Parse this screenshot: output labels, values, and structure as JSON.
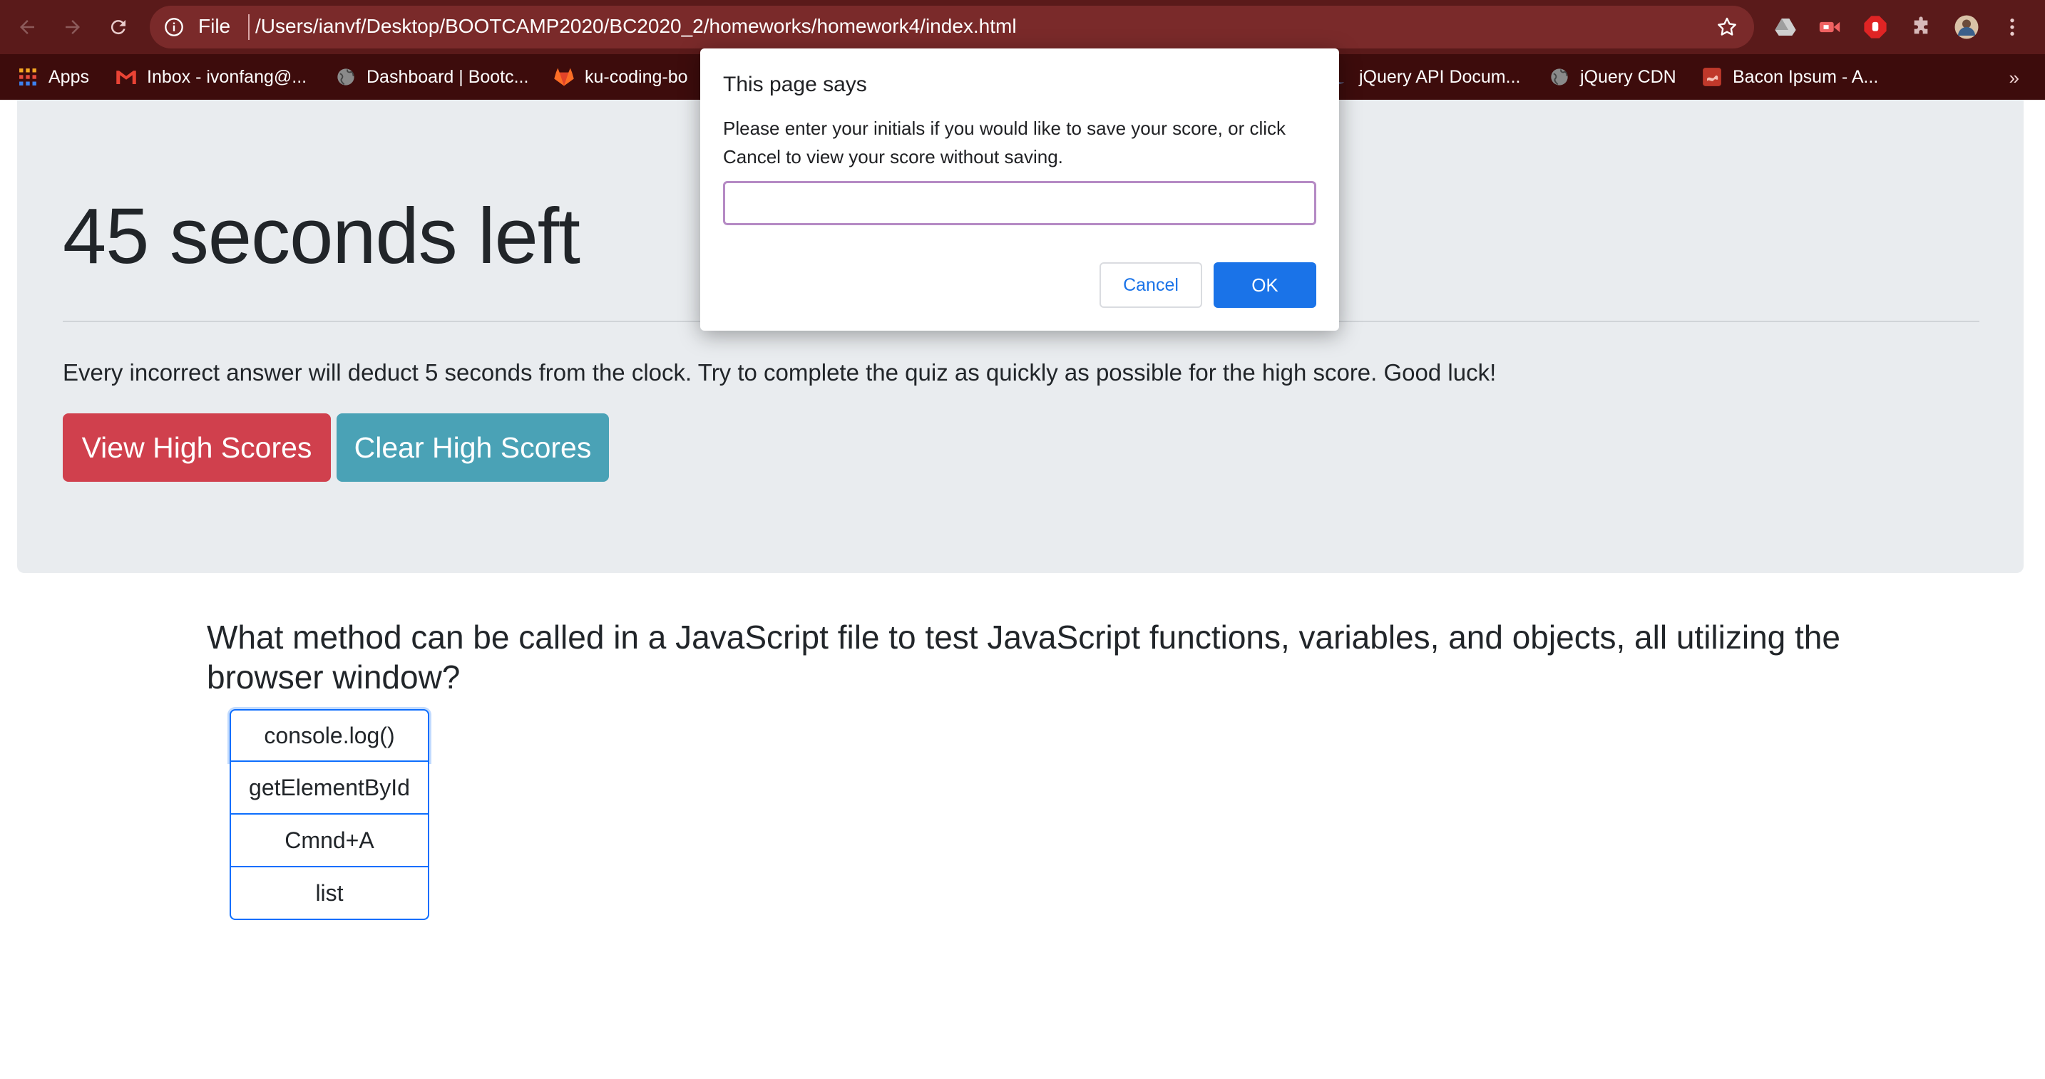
{
  "browser": {
    "scheme_label": "File",
    "url": "/Users/ianvf/Desktop/BOOTCAMP2020/BC2020_2/homeworks/homework4/index.html",
    "bookmarks": [
      {
        "label": "Apps",
        "icon": "apps-grid-icon"
      },
      {
        "label": "Inbox - ivonfang@...",
        "icon": "gmail-icon"
      },
      {
        "label": "Dashboard | Bootc...",
        "icon": "globe-icon"
      },
      {
        "label": "ku-coding-bo",
        "icon": "gitlab-icon"
      },
      {
        "label": "jQuery API Docum...",
        "icon": "jquery-icon"
      },
      {
        "label": "jQuery CDN",
        "icon": "globe-icon"
      },
      {
        "label": "Bacon Ipsum - A...",
        "icon": "bacon-ipsum-icon"
      }
    ],
    "more_bookmarks": "»"
  },
  "page": {
    "timer_text": "45 seconds left",
    "lead_text": "Every incorrect answer will deduct 5 seconds from the clock. Try to complete the quiz as quickly as possible for the high score. Good luck!",
    "view_high_scores": "View High Scores",
    "clear_high_scores": "Clear High Scores",
    "question": "What method can be called in a JavaScript file to test JavaScript functions, variables, and objects, all utilizing the browser window?",
    "answers": [
      "console.log()",
      "getElementById",
      "Cmnd+A",
      "list"
    ]
  },
  "dialog": {
    "title": "This page says",
    "message": "Please enter your initials if you would like to save your score, or click Cancel to view your score without saving.",
    "input_value": "",
    "cancel_label": "Cancel",
    "ok_label": "OK"
  },
  "colors": {
    "danger": "#d0404d",
    "info": "#4aa2b6",
    "primary": "#1a73e8",
    "jumbotron": "#e9ecef",
    "chrome_toolbar": "#5a1a1a"
  }
}
